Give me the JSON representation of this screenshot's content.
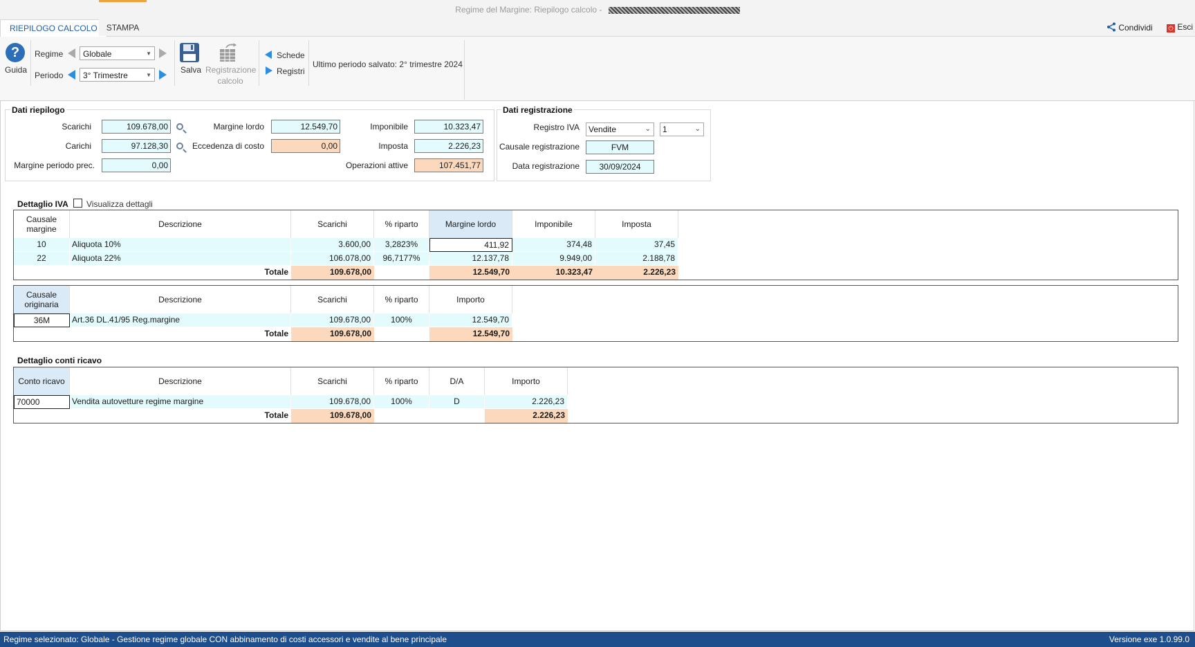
{
  "window": {
    "title": "Regime del Margine: Riepilogo calcolo - "
  },
  "tabs": [
    {
      "label": "RIEPILOGO CALCOLO",
      "active": true
    },
    {
      "label": "STAMPA",
      "active": false
    }
  ],
  "topbar": {
    "share_label": "Condividi",
    "exit_label": "Esci"
  },
  "ribbon": {
    "guide_label": "Guida",
    "regime_label": "Regime",
    "regime_value": "Globale",
    "periodo_label": "Periodo",
    "periodo_value": "3° Trimestre",
    "save_label": "Salva",
    "registration_label_1": "Registrazione",
    "registration_label_2": "calcolo",
    "schede_label": "Schede",
    "registri_label": "Registri",
    "last_period": "Ultimo periodo salvato: 2° trimestre 2024"
  },
  "riepilogo": {
    "title": "Dati riepilogo",
    "scarichi_label": "Scarichi",
    "scarichi": "109.678,00",
    "carichi_label": "Carichi",
    "carichi": "97.128,30",
    "margine_prec_label": "Margine periodo prec.",
    "margine_prec": "0,00",
    "margine_lordo_label": "Margine lordo",
    "margine_lordo": "12.549,70",
    "eccedenza_label": "Eccedenza di costo",
    "eccedenza": "0,00",
    "imponibile_label": "Imponibile",
    "imponibile": "10.323,47",
    "imposta_label": "Imposta",
    "imposta": "2.226,23",
    "operazioni_label": "Operazioni attive",
    "operazioni": "107.451,77"
  },
  "registrazione": {
    "title": "Dati registrazione",
    "registro_label": "Registro IVA",
    "registro_value": "Vendite",
    "registro_num": "1",
    "causale_label": "Causale registrazione",
    "causale_value": "FVM",
    "data_label": "Data registrazione",
    "data_value": "30/09/2024"
  },
  "dettaglio_iva": {
    "title": "Dettaglio IVA",
    "checkbox_label": "Visualizza dettagli",
    "headers": [
      "Causale margine",
      "Descrizione",
      "Scarichi",
      "% riparto",
      "Margine lordo",
      "Imponibile",
      "Imposta"
    ],
    "rows": [
      {
        "causale": "10",
        "descrizione": "Aliquota 10%",
        "scarichi": "3.600,00",
        "riparto": "3,2823%",
        "margine": "411,92",
        "imponibile": "374,48",
        "imposta": "37,45"
      },
      {
        "causale": "22",
        "descrizione": "Aliquota 22%",
        "scarichi": "106.078,00",
        "riparto": "96,7177%",
        "margine": "12.137,78",
        "imponibile": "9.949,00",
        "imposta": "2.188,78"
      }
    ],
    "total_label": "Totale",
    "totals": {
      "scarichi": "109.678,00",
      "margine": "12.549,70",
      "imponibile": "10.323,47",
      "imposta": "2.226,23"
    }
  },
  "causale_originaria": {
    "headers": [
      "Causale originaria",
      "Descrizione",
      "Scarichi",
      "% riparto",
      "Importo"
    ],
    "rows": [
      {
        "causale": "36M",
        "descrizione": "Art.36 DL.41/95 Reg.margine",
        "scarichi": "109.678,00",
        "riparto": "100%",
        "importo": "12.549,70"
      }
    ],
    "total_label": "Totale",
    "totals": {
      "scarichi": "109.678,00",
      "importo": "12.549,70"
    }
  },
  "conti_ricavo": {
    "title": "Dettaglio conti ricavo",
    "headers": [
      "Conto ricavo",
      "Descrizione",
      "Scarichi",
      "% riparto",
      "D/A",
      "Importo"
    ],
    "rows": [
      {
        "conto": "70000",
        "descrizione": "Vendita autovetture regime margine",
        "scarichi": "109.678,00",
        "riparto": "100%",
        "da": "D",
        "importo": "2.226,23"
      }
    ],
    "total_label": "Totale",
    "totals": {
      "scarichi": "109.678,00",
      "importo": "2.226,23"
    }
  },
  "statusbar": {
    "left": "Regime selezionato: Globale - Gestione regime globale CON abbinamento di costi accessori e vendite al bene principale",
    "right": "Versione exe 1.0.99.0"
  },
  "colors": {
    "status_bg": "#1f4e8c",
    "field_cyan": "#e3fbfc",
    "field_orange": "#fcd9bd",
    "accent_tab": "#1d5fa8",
    "tab_marker": "#f2a23a"
  }
}
